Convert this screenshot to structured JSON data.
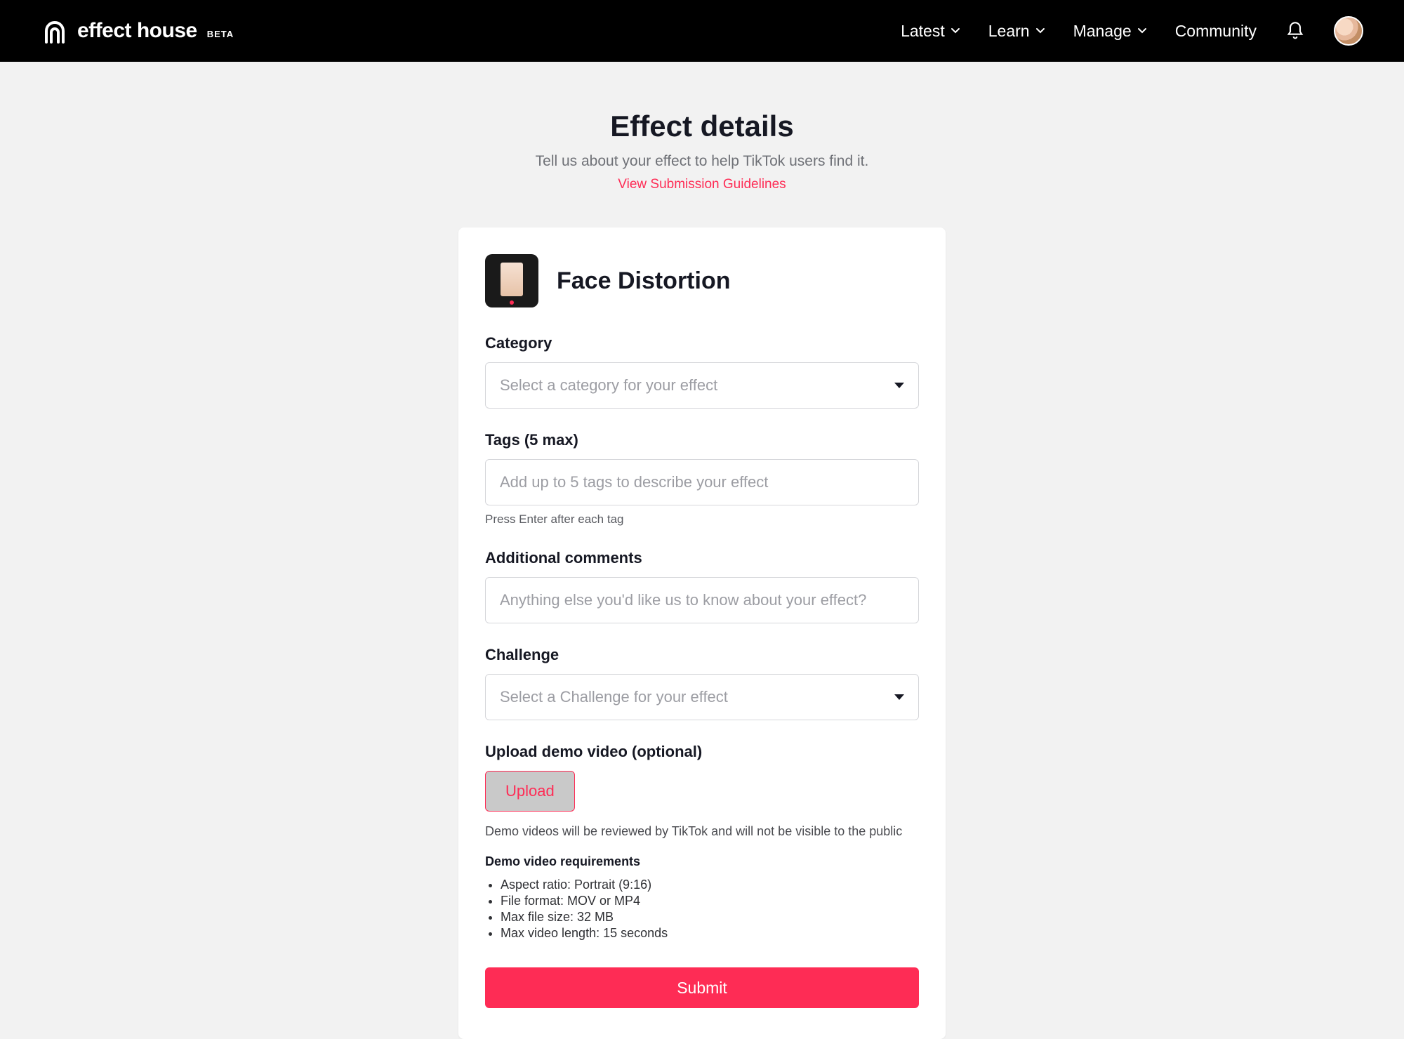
{
  "brand": {
    "name": "effect house",
    "tag": "BETA"
  },
  "nav": {
    "items": [
      {
        "label": "Latest",
        "hasChevron": true
      },
      {
        "label": "Learn",
        "hasChevron": true
      },
      {
        "label": "Manage",
        "hasChevron": true
      },
      {
        "label": "Community",
        "hasChevron": false
      }
    ]
  },
  "header": {
    "title": "Effect details",
    "subtitle": "Tell us about your effect to help TikTok users find it.",
    "guidelines_link": "View Submission Guidelines"
  },
  "effect": {
    "name": "Face Distortion"
  },
  "form": {
    "category": {
      "label": "Category",
      "placeholder": "Select a category for your effect"
    },
    "tags": {
      "label": "Tags (5 max)",
      "placeholder": "Add up to 5 tags to describe your effect",
      "hint": "Press Enter after each tag"
    },
    "comments": {
      "label": "Additional comments",
      "placeholder": "Anything else you'd like us to know about your effect?"
    },
    "challenge": {
      "label": "Challenge",
      "placeholder": "Select a Challenge for your effect"
    },
    "upload": {
      "label": "Upload demo video (optional)",
      "button": "Upload",
      "note": "Demo videos will be reviewed by TikTok and will not be visible to the public",
      "requirements_title": "Demo video requirements",
      "requirements": [
        "Aspect ratio: Portrait (9:16)",
        "File format: MOV or MP4",
        "Max file size: 32 MB",
        "Max video length: 15 seconds"
      ]
    },
    "submit_label": "Submit"
  },
  "colors": {
    "accent": "#fe2c55"
  }
}
